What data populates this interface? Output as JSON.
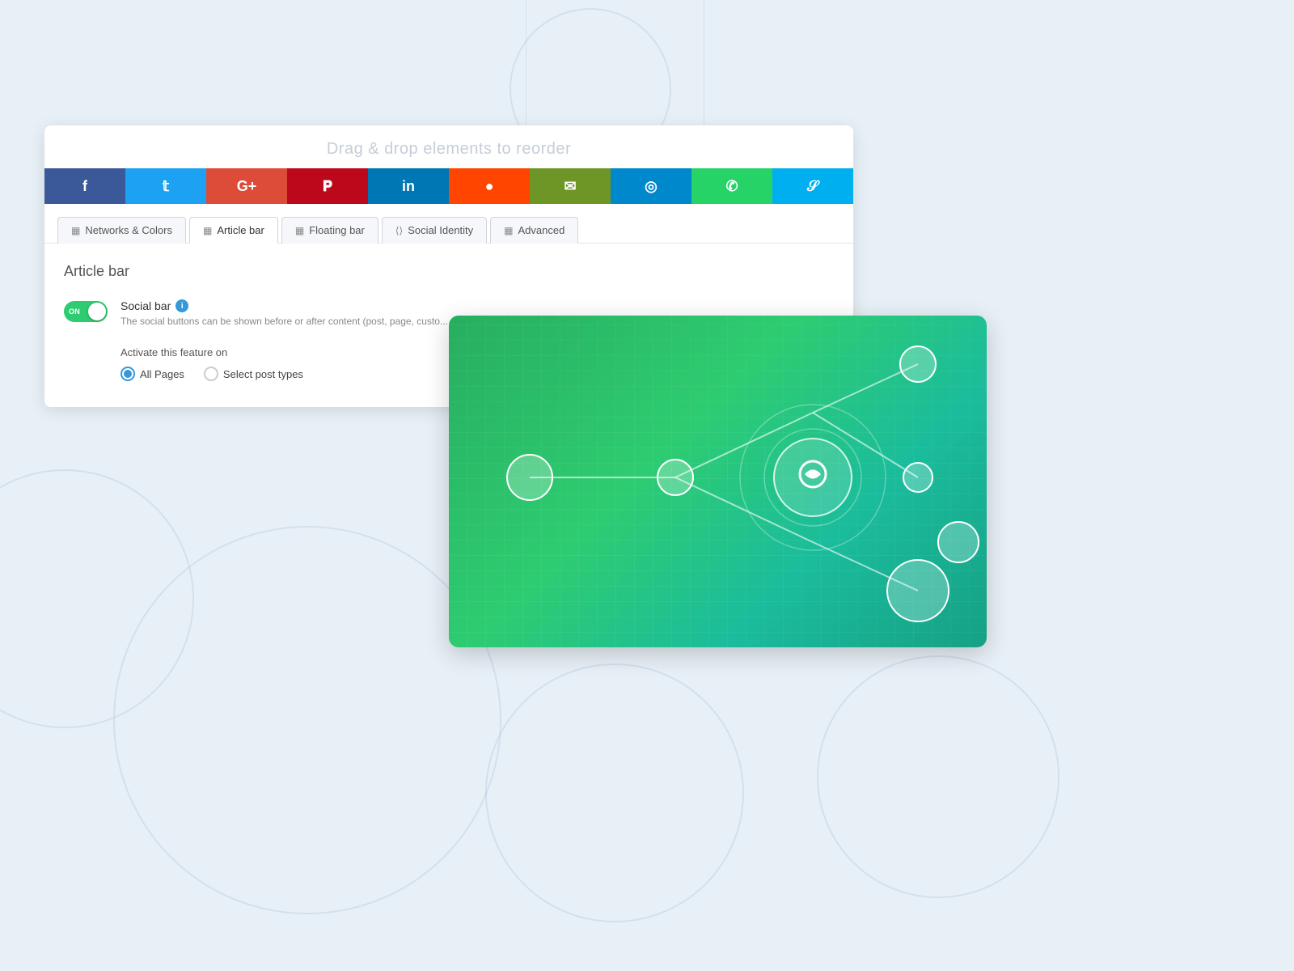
{
  "page": {
    "bg_color": "#e8f0f7"
  },
  "drag_header": {
    "text": "Drag & drop elements to reorder"
  },
  "social_buttons": [
    {
      "label": "f",
      "color": "#3b5998",
      "name": "facebook"
    },
    {
      "label": "𝕥",
      "color": "#1da1f2",
      "name": "twitter"
    },
    {
      "label": "G+",
      "color": "#dd4b39",
      "name": "google-plus"
    },
    {
      "label": "𝐏",
      "color": "#bd081c",
      "name": "pinterest"
    },
    {
      "label": "in",
      "color": "#0077b5",
      "name": "linkedin"
    },
    {
      "label": "●",
      "color": "#ff4500",
      "name": "reddit"
    },
    {
      "label": "✉",
      "color": "#6d9627",
      "name": "email"
    },
    {
      "label": "◎",
      "color": "#0088cc",
      "name": "telegram"
    },
    {
      "label": "✆",
      "color": "#25d366",
      "name": "whatsapp"
    },
    {
      "label": "𝒮",
      "color": "#00aff0",
      "name": "skype"
    }
  ],
  "tabs": [
    {
      "label": "Networks & Colors",
      "icon": "grid",
      "active": false,
      "name": "networks-colors-tab"
    },
    {
      "label": "Article bar",
      "icon": "grid",
      "active": true,
      "name": "article-bar-tab"
    },
    {
      "label": "Floating bar",
      "icon": "grid",
      "active": false,
      "name": "floating-bar-tab"
    },
    {
      "label": "Social Identity",
      "icon": "share",
      "active": false,
      "name": "social-identity-tab"
    },
    {
      "label": "Advanced",
      "icon": "grid",
      "active": false,
      "name": "advanced-tab"
    }
  ],
  "content": {
    "section_title": "Article bar",
    "toggle": {
      "state": "ON",
      "title": "Social bar",
      "description": "The social buttons can be shown before or after content (post, page, custo..."
    },
    "activate": {
      "title": "Activate this feature on",
      "options": [
        {
          "label": "All Pages",
          "selected": true
        },
        {
          "label": "Select post types",
          "selected": false
        }
      ]
    }
  }
}
